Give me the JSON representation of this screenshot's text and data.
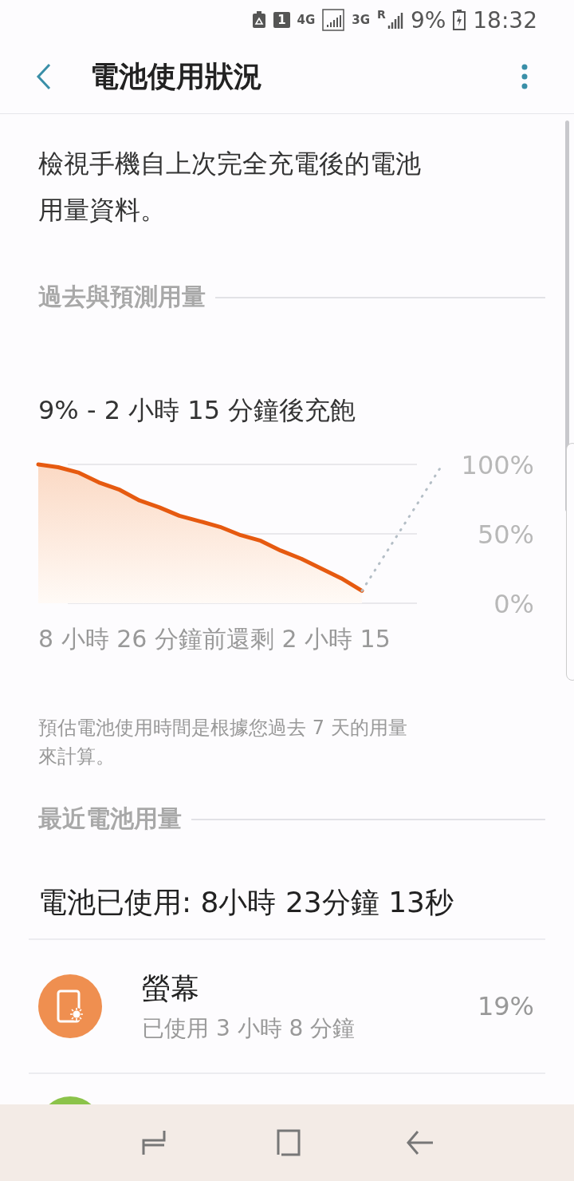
{
  "status_bar": {
    "sim": "1",
    "network_1": "4G",
    "network_2": "3G",
    "roaming": "R",
    "battery": "9%",
    "time": "18:32"
  },
  "header": {
    "title": "電池使用狀況"
  },
  "description": "檢視手機自上次完全充電後的電池用量資料。",
  "history": {
    "heading": "過去與預測用量",
    "summary": "9% - 2 小時 15 分鐘後充飽",
    "axis_labels": [
      "100%",
      "50%",
      "0%"
    ],
    "time_label": "8 小時 26 分鐘前還剩 2 小時 15",
    "note": "預估電池使用時間是根據您過去 7 天的用量來計算。"
  },
  "recent": {
    "heading": "最近電池用量",
    "total": "電池已使用: 8小時 23分鐘 13秒",
    "items": [
      {
        "kind": "screen",
        "color": "#ef8f50",
        "name": "螢幕",
        "usage": "已使用 3 小時 8 分鐘",
        "percent": "19%"
      },
      {
        "kind": "app",
        "color": "#8bc34a"
      }
    ]
  }
}
